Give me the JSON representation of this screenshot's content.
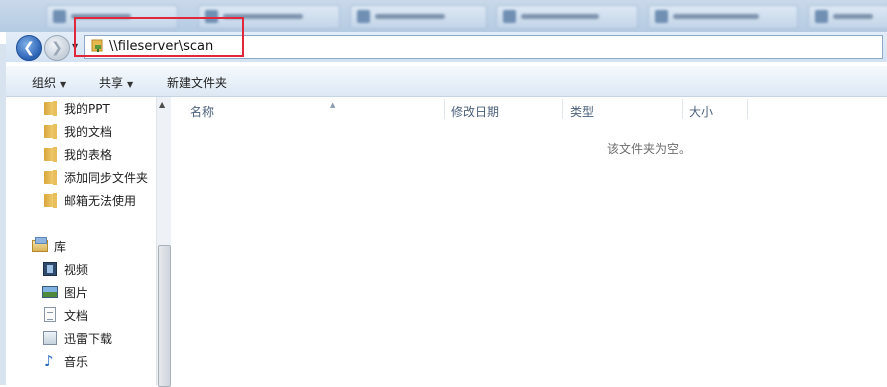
{
  "address": {
    "path": "\\\\fileserver\\scan"
  },
  "toolbar": {
    "organize": "组织",
    "share": "共享",
    "new_folder": "新建文件夹"
  },
  "nav": {
    "folders": [
      "我的PPT",
      "我的文档",
      "我的表格",
      "添加同步文件夹",
      "邮箱无法使用"
    ],
    "library_label": "库",
    "libraries": [
      {
        "label": "视频",
        "icon": "video-icon"
      },
      {
        "label": "图片",
        "icon": "pictures-icon"
      },
      {
        "label": "文档",
        "icon": "documents-icon"
      },
      {
        "label": "迅雷下载",
        "icon": "thunder-download-icon"
      },
      {
        "label": "音乐",
        "icon": "music-icon"
      }
    ]
  },
  "columns": {
    "name": "名称",
    "modified": "修改日期",
    "type": "类型",
    "size": "大小"
  },
  "empty_message": "该文件夹为空。",
  "colors": {
    "highlight_box": "#e0283a",
    "back_button": "#2a62b4"
  }
}
